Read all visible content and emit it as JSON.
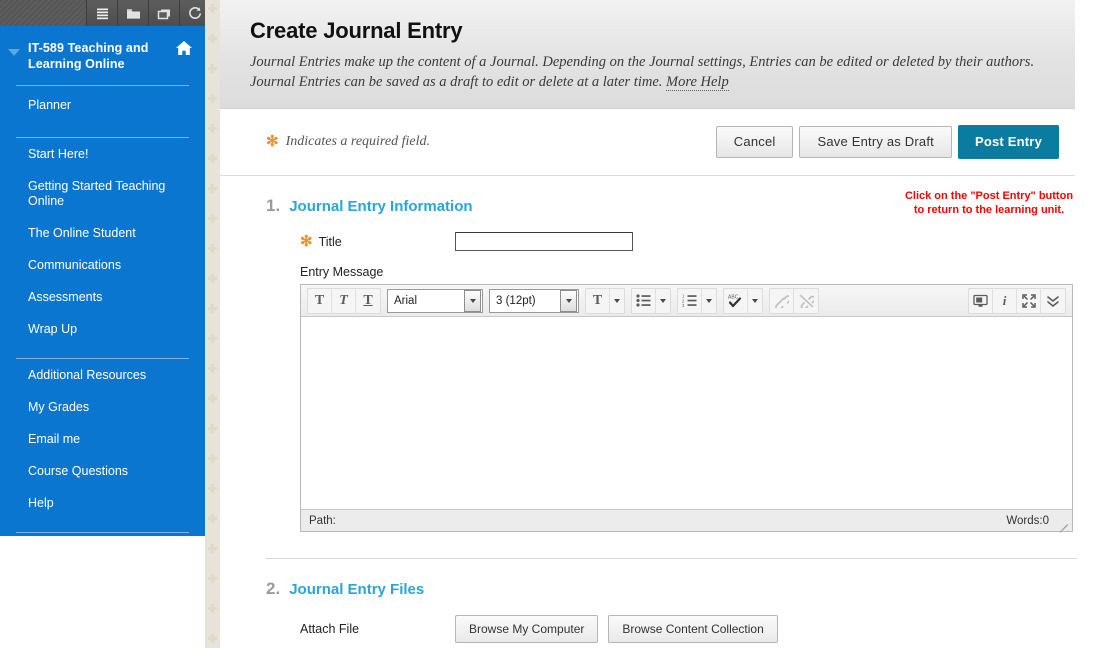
{
  "topbar": {
    "icons": [
      {
        "name": "menu-icon",
        "label": "Menu"
      },
      {
        "name": "folder-icon",
        "label": "Folder"
      },
      {
        "name": "window-icon",
        "label": "Window"
      },
      {
        "name": "refresh-icon",
        "label": "Refresh"
      }
    ]
  },
  "sidebar": {
    "course_title": "IT-589 Teaching and Learning Online",
    "home_icon": "home-icon",
    "caret_icon": "chevron-down-icon",
    "planner": "Planner",
    "group_one": [
      "Start Here!",
      "Getting Started Teaching Online",
      "The Online Student",
      "Communications",
      "Assessments",
      "Wrap Up"
    ],
    "group_two": [
      "Additional Resources",
      "My Grades",
      "Email me",
      "Course Questions",
      "Help"
    ],
    "accent_color": "#0b76cf"
  },
  "header": {
    "title": "Create Journal Entry",
    "description": "Journal Entries make up the content of a Journal. Depending on the Journal settings, Entries can be edited or deleted by their authors. Journal Entries can be saved as a draft to edit or delete at a later time. ",
    "more_help": "More Help"
  },
  "action_bar": {
    "required_note": "Indicates a required field.",
    "asterisk": "✻",
    "cancel": "Cancel",
    "save_draft": "Save Entry as Draft",
    "post_entry": "Post Entry",
    "primary_color": "#0a7ca0"
  },
  "annotation": {
    "text": "Click on the \"Post Entry\" button\nto  return to the learning unit.",
    "color": "#ff0000"
  },
  "section1": {
    "number": "1.",
    "title": "Journal Entry Information",
    "title_label": "Title",
    "title_value": "",
    "title_placeholder": "",
    "entry_message_label": "Entry Message"
  },
  "editor": {
    "font_family": "Arial",
    "font_size": "3 (12pt)",
    "bold_icon": "bold-icon",
    "italic_icon": "italic-icon",
    "underline_icon": "underline-icon",
    "text_color_icon": "text-color-icon",
    "bullet_list_icon": "bullet-list-icon",
    "numbered_list_icon": "numbered-list-icon",
    "spellcheck_icon": "spellcheck-icon",
    "link_icon": "link-icon",
    "unlink_icon": "unlink-icon",
    "preview_icon": "preview-icon",
    "info_icon": "info-icon",
    "fullscreen_icon": "fullscreen-icon",
    "expand_icon": "double-chevron-down-icon",
    "content": "",
    "path_label": "Path:",
    "path_value": "",
    "words_label": "Words:0"
  },
  "section2": {
    "number": "2.",
    "title": "Journal Entry Files",
    "attach_label": "Attach File",
    "browse_computer": "Browse My Computer",
    "browse_collection": "Browse Content Collection"
  }
}
